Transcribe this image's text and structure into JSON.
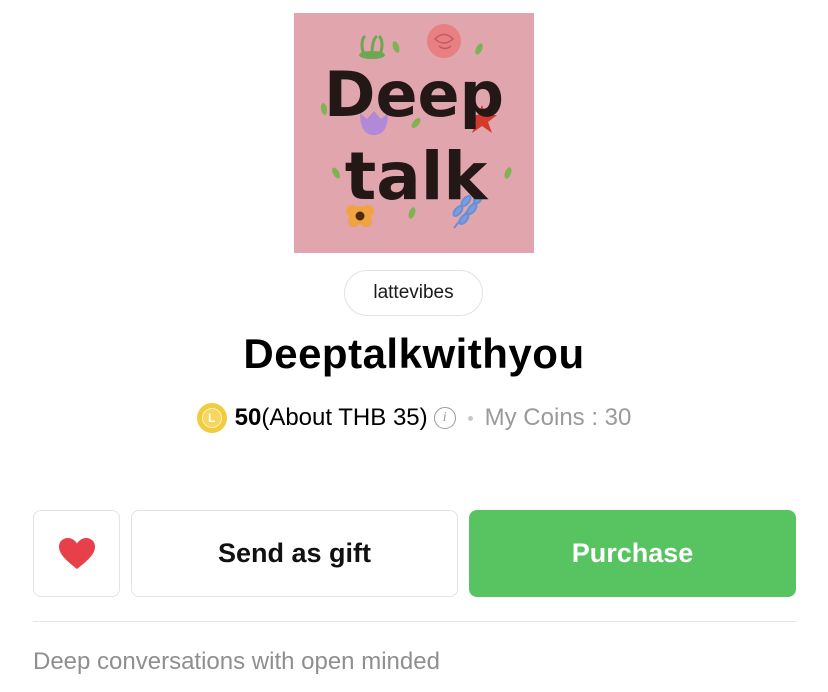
{
  "product": {
    "cover_text_line1": "Deep",
    "cover_text_line2": "talk",
    "author": "lattevibes",
    "title": "Deeptalkwithyou",
    "coin_letter": "L",
    "price_amount": "50",
    "price_approx": "(About THB 35)",
    "info_glyph": "i",
    "my_coins": "My Coins : 30",
    "description": "Deep conversations with open minded"
  },
  "actions": {
    "favorite_icon": "heart-icon",
    "gift_label": "Send as gift",
    "purchase_label": "Purchase"
  },
  "colors": {
    "cover_bg": "#e0a5ad",
    "purchase_green": "#57c461",
    "heart_red": "#e8404a",
    "coin_yellow": "#f2cc3f"
  }
}
